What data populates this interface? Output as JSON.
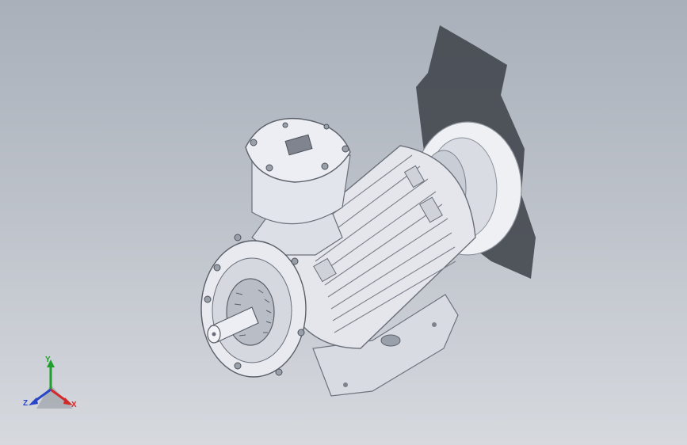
{
  "viewport": {
    "background_top": "#a9b0ba",
    "background_bottom": "#d6d9de",
    "model_color": "#e6e8ef",
    "shadow_color": "#3a3d44"
  },
  "model": {
    "name": "motor-assembly",
    "parts": [
      "motor-frame",
      "terminal-box",
      "shaft",
      "end-shield",
      "fan-cover",
      "mounting-foot"
    ]
  },
  "triad": {
    "x_label": "X",
    "y_label": "Y",
    "z_label": "Z",
    "x_color": "#d22a2a",
    "y_color": "#1f9e2c",
    "z_color": "#2a46c8"
  }
}
